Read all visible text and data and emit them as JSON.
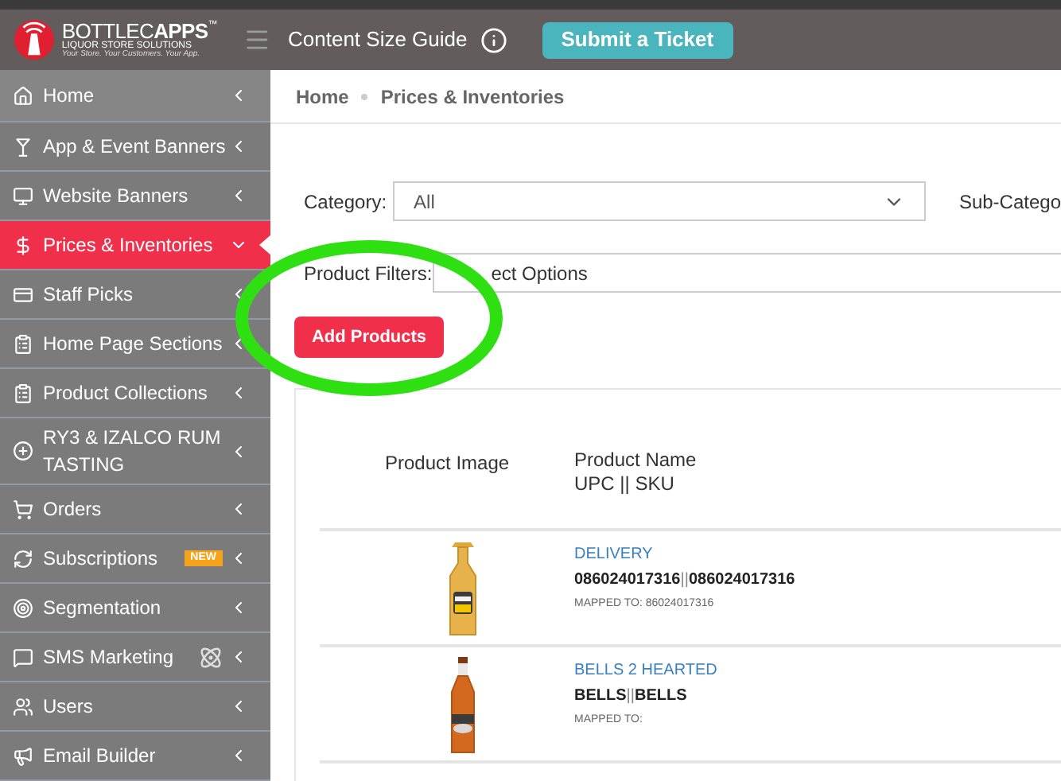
{
  "header": {
    "logo": {
      "name": "BOTTLEC**APPS**",
      "tm": "™",
      "subtitle": "LIQUOR STORE SOLUTIONS",
      "tagline": "Your Store. Your Customers. Your App."
    },
    "guide": "Content Size Guide",
    "ticket_button": "Submit a Ticket"
  },
  "sidebar": {
    "items": [
      {
        "label": "Home",
        "kind": "home",
        "selected": false,
        "expanded": false
      },
      {
        "label": "App & Event Banners",
        "kind": "martini",
        "selected": false,
        "expanded": false
      },
      {
        "label": "Website Banners",
        "kind": "monitor",
        "selected": false,
        "expanded": false
      },
      {
        "label": "Prices & Inventories",
        "kind": "dollar",
        "selected": true,
        "expanded": true
      },
      {
        "label": "Staff Picks",
        "kind": "card",
        "selected": false,
        "expanded": false
      },
      {
        "label": "Home Page Sections",
        "kind": "clipboard",
        "selected": false,
        "expanded": false
      },
      {
        "label": "Product Collections",
        "kind": "clipboard",
        "selected": false,
        "expanded": false
      },
      {
        "label": "RY3 & IZALCO RUM TASTING",
        "kind": "plus",
        "selected": false,
        "expanded": false
      },
      {
        "label": "Orders",
        "kind": "cart",
        "selected": false,
        "expanded": false
      },
      {
        "label": "Subscriptions",
        "kind": "refresh",
        "selected": false,
        "expanded": false,
        "badge": "NEW"
      },
      {
        "label": "Segmentation",
        "kind": "target",
        "selected": false,
        "expanded": false
      },
      {
        "label": "SMS Marketing",
        "kind": "message",
        "selected": false,
        "expanded": false,
        "ai": true
      },
      {
        "label": "Users",
        "kind": "users",
        "selected": false,
        "expanded": false
      },
      {
        "label": "Email Builder",
        "kind": "megaphone",
        "selected": false,
        "expanded": false
      }
    ]
  },
  "breadcrumb": [
    "Home",
    "Prices & Inventories"
  ],
  "filters": {
    "category_label": "Category:",
    "category_value": "All",
    "subcategory_label": "Sub-Catego",
    "product_filters_label": "Product Filters:",
    "product_filters_placeholder": "ect Options"
  },
  "add_button": "Add Products",
  "table": {
    "columns": [
      "Product Image",
      "Product Name",
      "UPC || SKU"
    ],
    "rows": [
      {
        "kind": "tequila",
        "name": "DELIVERY",
        "code": "**086024017316**||**086024017316**",
        "mapped": "MAPPED TO: 86024017316"
      },
      {
        "kind": "beer",
        "name": "BELLS 2 HEARTED",
        "code": "**BELLS**||**BELLS**",
        "mapped": "MAPPED TO:"
      }
    ]
  }
}
